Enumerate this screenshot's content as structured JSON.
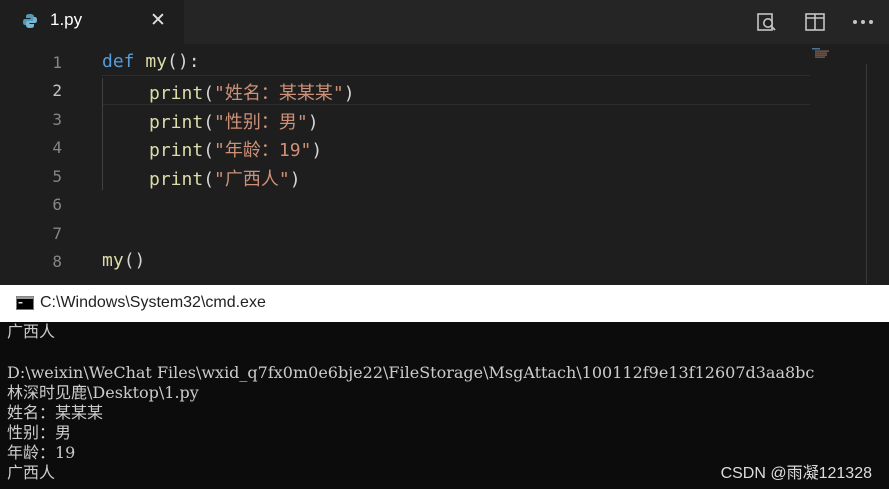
{
  "editor": {
    "tab": {
      "file_name": "1.py"
    },
    "line_numbers": [
      "1",
      "2",
      "3",
      "4",
      "5",
      "6",
      "7",
      "8"
    ],
    "code": {
      "l1": {
        "kw": "def",
        "fn": "my",
        "punc": "():"
      },
      "l2": {
        "fn": "print",
        "open": "(",
        "str": "\"姓名：某某某\"",
        "close": ")"
      },
      "l3": {
        "fn": "print",
        "open": "(",
        "str": "\"性别：男\"",
        "close": ")"
      },
      "l4": {
        "fn": "print",
        "open": "(",
        "str": "\"年龄：19\"",
        "close": ")"
      },
      "l5": {
        "fn": "print",
        "open": "(",
        "str": "\"广西人\"",
        "close": ")"
      },
      "l8": {
        "fn": "my",
        "punc": "()"
      }
    },
    "active_line": "2"
  },
  "cmd": {
    "title": "C:\\Windows\\System32\\cmd.exe",
    "lines": [
      "广西人",
      "",
      "D:\\weixin\\WeChat Files\\wxid_q7fx0m0e6bje22\\FileStorage\\MsgAttach\\100112f9e13f12607d3aa8bc",
      "林深时见鹿\\Desktop\\1.py",
      "姓名：某某某",
      "性别：男",
      "年龄：19",
      "广西人"
    ]
  },
  "watermark": "CSDN @雨凝121328",
  "colors": {
    "keyword": "#569cd6",
    "function": "#dcdcaa",
    "string": "#ce9178",
    "editor_bg": "#1e1e1e",
    "console_bg": "#0c0c0c"
  }
}
